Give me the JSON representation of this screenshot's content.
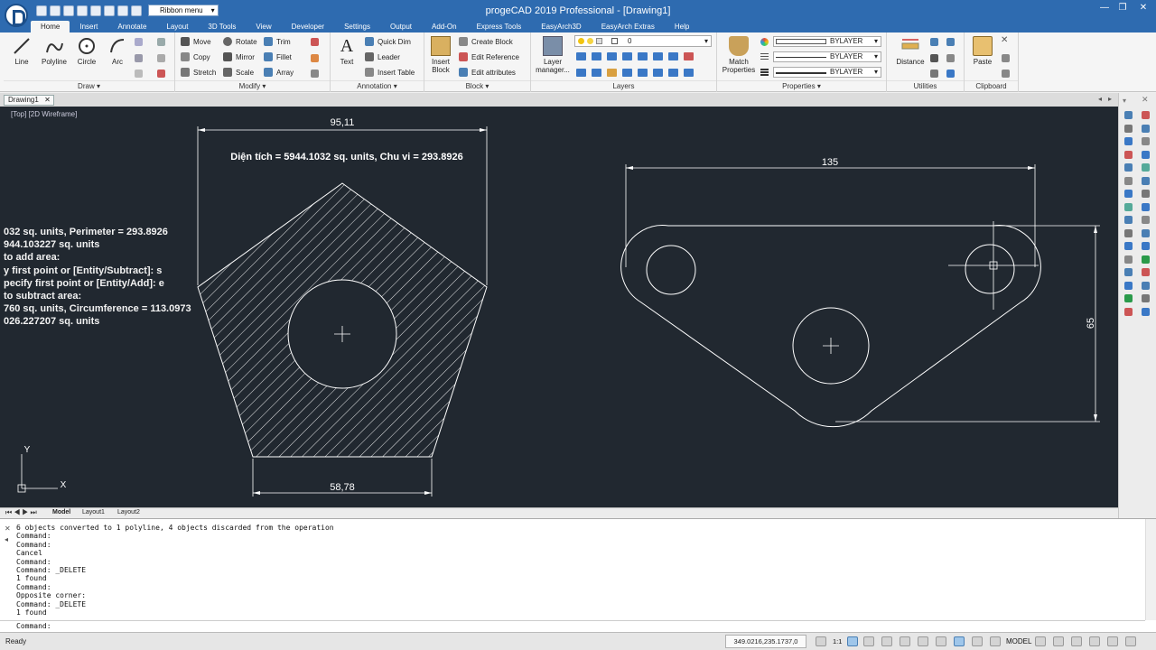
{
  "window": {
    "title": "progeCAD 2019 Professional - [Drawing1]",
    "workspace": "Ribbon menu"
  },
  "ribbon_tabs": [
    "Home",
    "Insert",
    "Annotate",
    "Layout",
    "3D Tools",
    "View",
    "Developer",
    "Settings",
    "Output",
    "Add-On",
    "Express Tools",
    "EasyArch3D",
    "EasyArch Extras",
    "Help"
  ],
  "ribbon": {
    "draw": {
      "label": "Draw ▾",
      "line": "Line",
      "polyline": "Polyline",
      "circle": "Circle",
      "arc": "Arc"
    },
    "modify": {
      "label": "Modify ▾",
      "move": "Move",
      "rotate": "Rotate",
      "trim": "Trim",
      "copy": "Copy",
      "mirror": "Mirror",
      "fillet": "Fillet",
      "stretch": "Stretch",
      "scale": "Scale",
      "array": "Array"
    },
    "annotation": {
      "label": "Annotation ▾",
      "text": "Text",
      "quick_dim": "Quick Dim",
      "leader": "Leader",
      "insert_table": "Insert Table"
    },
    "block": {
      "label": "Block ▾",
      "insert": "Insert Block",
      "create": "Create Block",
      "edit_ref": "Edit Reference",
      "edit_attr": "Edit attributes"
    },
    "layers": {
      "label": "Layers",
      "manager": "Layer manager...",
      "current_layer": "0"
    },
    "properties": {
      "label": "Properties ▾",
      "match": "Match Properties",
      "color": "BYLAYER",
      "linetype": "BYLAYER",
      "lineweight": "BYLAYER"
    },
    "utilities": {
      "label": "Utilities",
      "distance": "Distance"
    },
    "clipboard": {
      "label": "Clipboard",
      "paste": "Paste"
    }
  },
  "document_tab": "Drawing1",
  "viewport_label": "[Top] [2D Wireframe]",
  "drawing": {
    "pentagon_top_dim": "95,11",
    "pentagon_bottom_dim": "58,78",
    "area_text": "Diện tích = 5944.1032 sq. units, Chu vi = 293.8926",
    "part_width_dim": "135",
    "part_height_dim": "65",
    "ucs_y": "Y",
    "ucs_x": "X"
  },
  "canvas_command_overlay": [
    "032 sq. units, Perimeter = 293.8926",
    "944.103227 sq. units",
    "to add area:",
    "y first point or [Entity/Subtract]: s",
    "pecify first point or [Entity/Add]: e",
    "to subtract area:",
    "760 sq. units, Circumference = 113.0973",
    "026.227207 sq. units"
  ],
  "layout_tabs": [
    "Model",
    "Layout1",
    "Layout2"
  ],
  "command_history": [
    "6 objects converted to 1 polyline, 4 objects discarded from the operation",
    "Command:",
    "Command:",
    "Cancel",
    "Command:",
    "Command: _DELETE",
    "1 found",
    "Command:",
    "Opposite corner:",
    "Command: _DELETE",
    "1 found"
  ],
  "command_prompt": "Command:",
  "status": {
    "ready": "Ready",
    "coordinates": "349.0216,235.1737,0",
    "scale": "1:1",
    "model": "MODEL"
  },
  "colors": {
    "titlebar": "#2e6bb0",
    "canvas": "#212830",
    "hatch": "#ffffff"
  }
}
